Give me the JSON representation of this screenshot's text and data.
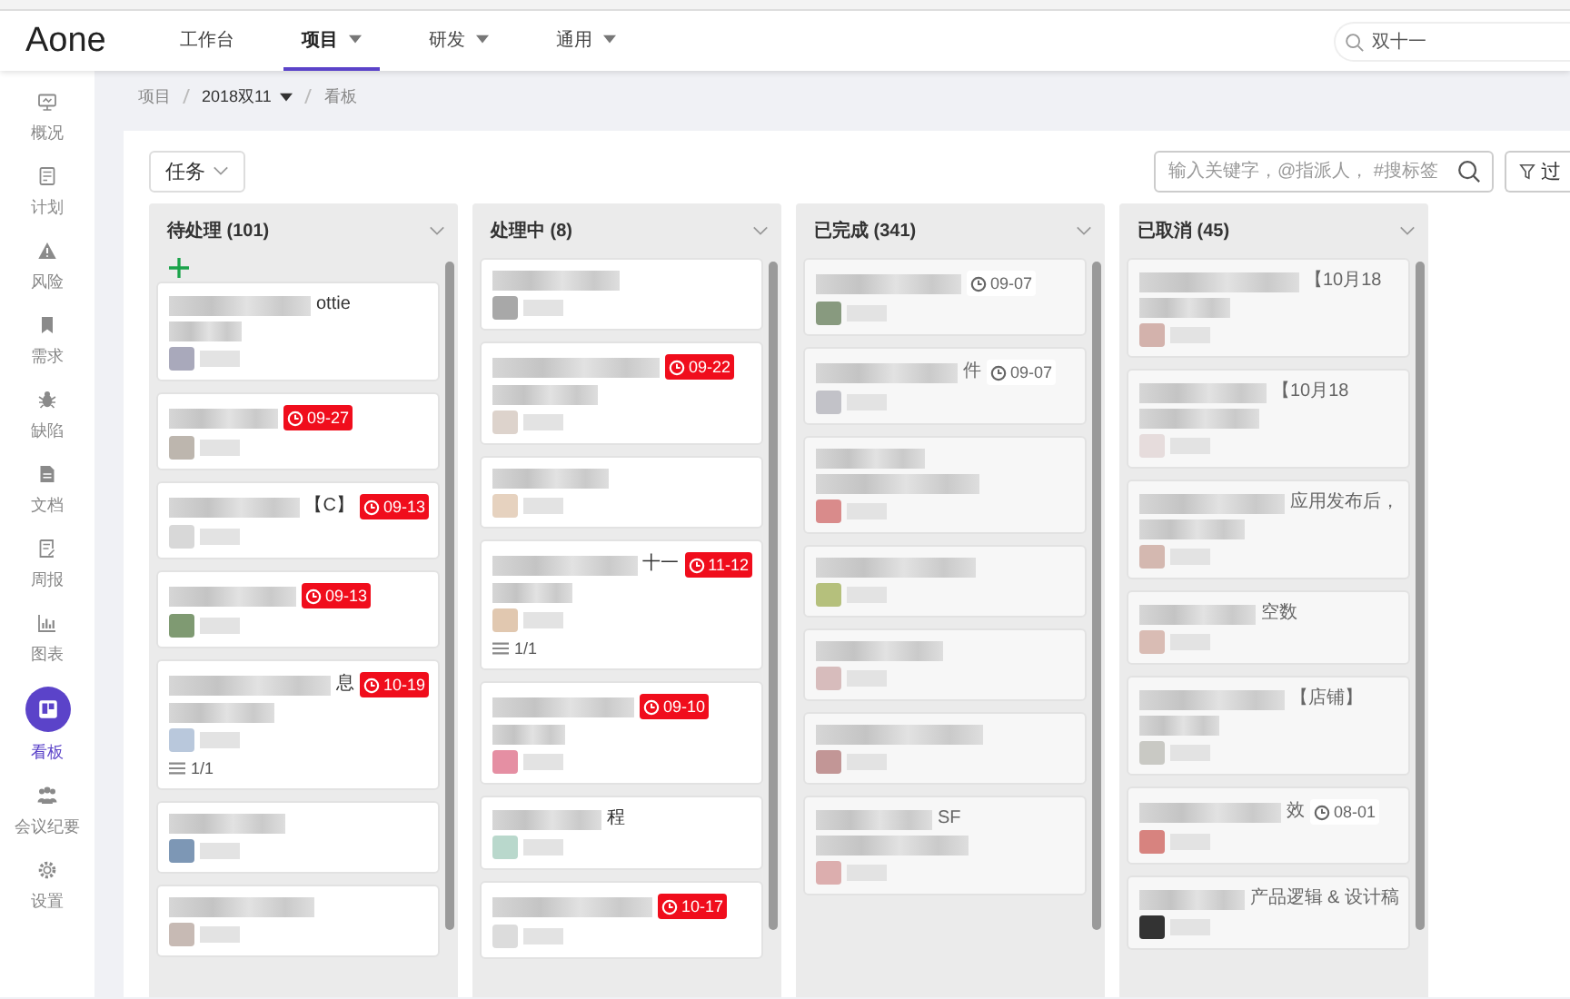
{
  "app": {
    "logo": "Aone"
  },
  "nav": [
    {
      "label": "工作台",
      "has_menu": false,
      "selected": false
    },
    {
      "label": "项目",
      "has_menu": true,
      "selected": true
    },
    {
      "label": "研发",
      "has_menu": true,
      "selected": false
    },
    {
      "label": "通用",
      "has_menu": true,
      "selected": false
    }
  ],
  "global_search": {
    "value": "双十一"
  },
  "sidebar": [
    {
      "kind": "overview",
      "label": "概况",
      "selected": false
    },
    {
      "kind": "plan",
      "label": "计划",
      "selected": false
    },
    {
      "kind": "risk",
      "label": "风险",
      "selected": false
    },
    {
      "kind": "bookmark",
      "label": "需求",
      "selected": false
    },
    {
      "kind": "bug",
      "label": "缺陷",
      "selected": false
    },
    {
      "kind": "doc",
      "label": "文档",
      "selected": false
    },
    {
      "kind": "report",
      "label": "周报",
      "selected": false
    },
    {
      "kind": "chart",
      "label": "图表",
      "selected": false
    },
    {
      "kind": "board",
      "label": "看板",
      "selected": true
    },
    {
      "kind": "people",
      "label": "会议纪要",
      "selected": false
    },
    {
      "kind": "gear",
      "label": "设置",
      "selected": false
    }
  ],
  "breadcrumb": [
    {
      "label": "项目",
      "has_menu": false
    },
    {
      "label": "2018双11",
      "has_menu": true
    },
    {
      "label": "看板",
      "has_menu": false
    }
  ],
  "type_select": {
    "value": "任务"
  },
  "board_search": {
    "placeholder": "输入关键字，@指派人， #搜标签"
  },
  "filter_button": {
    "label": "过"
  },
  "columns": [
    {
      "title": "待处理 (101)",
      "can_add": true,
      "muted": false,
      "cards": [
        {
          "text": "ottie",
          "kind": "tall",
          "color": "#a9a9bb"
        },
        {
          "due": "09-27",
          "overdue": true,
          "color": "#bdb6ae"
        },
        {
          "text": "【C】",
          "due": "09-13",
          "overdue": true,
          "color": "#d8d8d8"
        },
        {
          "due": "09-13",
          "overdue": true,
          "color": "#7f9a72"
        },
        {
          "text": "息",
          "due": "10-19",
          "overdue": true,
          "subtasks": "1/1",
          "kind": "tall",
          "color": "#b9c8dc"
        },
        {
          "color": "#7d97b5"
        },
        {
          "color": "#c7bab4"
        }
      ]
    },
    {
      "title": "处理中 (8)",
      "can_add": false,
      "muted": false,
      "cards": [
        {
          "color": "#a8a8a8"
        },
        {
          "due": "09-22",
          "overdue": true,
          "kind": "tall",
          "color": "#ddd3cc"
        },
        {
          "color": "#e6d2bf"
        },
        {
          "text": "十一",
          "due": "11-12",
          "overdue": true,
          "subtasks": "1/1",
          "kind": "tall",
          "color": "#e1c8b0"
        },
        {
          "due": "09-10",
          "overdue": true,
          "kind": "tall",
          "color": "#e58fa3"
        },
        {
          "text": "程",
          "color": "#b9d8cc"
        },
        {
          "due": "10-17",
          "overdue": true,
          "color": "#dcdcdc"
        }
      ]
    },
    {
      "title": "已完成 (341)",
      "can_add": false,
      "muted": true,
      "cards": [
        {
          "due": "09-07",
          "overdue": false,
          "color": "#889a7f"
        },
        {
          "text": "件",
          "due": "09-07",
          "overdue": false,
          "color": "#c2c2c8"
        },
        {
          "kind": "tall",
          "color": "#d98b8b"
        },
        {
          "color": "#b5c07c"
        },
        {
          "color": "#d7bcbc"
        },
        {
          "color": "#c29696"
        },
        {
          "text": "SF",
          "kind": "tall",
          "color": "#dcaeae"
        }
      ]
    },
    {
      "title": "已取消 (45)",
      "can_add": false,
      "muted": true,
      "cards": [
        {
          "text": "【10月18",
          "kind": "tall",
          "color": "#d3b2ac"
        },
        {
          "text": "【10月18",
          "kind": "tall",
          "color": "#e6dcdc"
        },
        {
          "text": "应用发布后，",
          "kind": "tall",
          "color": "#d4b8b0"
        },
        {
          "text": "空数",
          "color": "#d9bcb4"
        },
        {
          "text": "【店铺】",
          "kind": "tall",
          "color": "#c9c9c4"
        },
        {
          "text": "效",
          "due": "08-01",
          "overdue": false,
          "color": "#d7837f"
        },
        {
          "text": "产品逻辑 & 设计稿",
          "color": "#333333"
        }
      ]
    }
  ]
}
